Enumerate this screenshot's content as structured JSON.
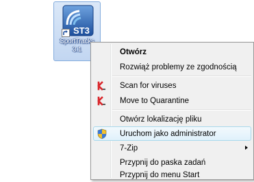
{
  "desktop_icon": {
    "badge_text": "ST3",
    "label_line1": "SportTracks",
    "label_line2": "3.1"
  },
  "context_menu": {
    "items": [
      {
        "label": "Otwórz",
        "bold": true
      },
      {
        "label": "Rozwiąż problemy ze zgodnością"
      },
      {
        "label": "Scan for viruses",
        "icon": "kaspersky-icon"
      },
      {
        "label": "Move to Quarantine",
        "icon": "kaspersky-icon"
      },
      {
        "label": "Otwórz lokalizację pliku"
      },
      {
        "label": "Uruchom jako administrator",
        "icon": "uac-shield-icon",
        "highlighted": true
      },
      {
        "label": "7-Zip",
        "submenu": true
      },
      {
        "label": "Przypnij do paska zadań"
      },
      {
        "label": "Przypnij do menu Start"
      }
    ]
  },
  "colors": {
    "menu_background": "#f0f0f0",
    "menu_border": "#979797",
    "highlight_border": "#a8d8eb",
    "selection_background": "#c2d6f1",
    "kaspersky_red": "#d9262b"
  }
}
